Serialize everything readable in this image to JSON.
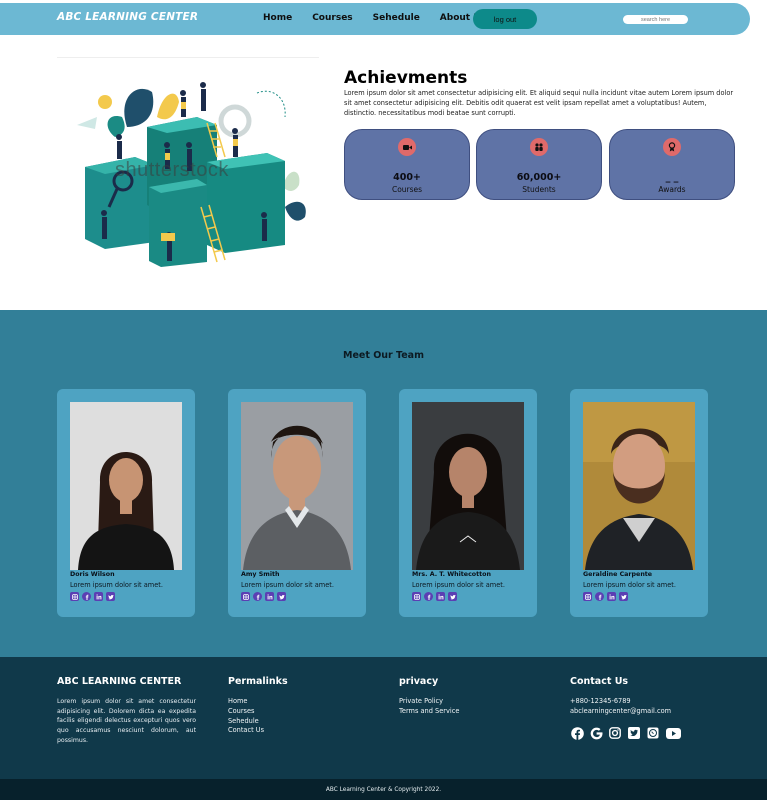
{
  "nav": {
    "brand": "ABC LEARNING CENTER",
    "links": [
      "Home",
      "Courses",
      "Sehedule",
      "About Us"
    ],
    "logout_label": "log out",
    "search_placeholder": "search here"
  },
  "achievements": {
    "title": "Achievments",
    "text": "Lorem ipsum dolor sit amet consectetur adipisicing elit. Et aliquid sequi nulla incidunt vitae autem Lorem ipsum dolor sit amet consectetur adipisicing elit. Debitis odit quaerat est velit ipsam repellat amet a voluptatibus! Autem, distinctio. necessitatibus modi beatae sunt corrupti.",
    "watermark": "shutterstock",
    "stats": [
      {
        "icon": "video-camera-icon",
        "value": "400+",
        "label": "Courses"
      },
      {
        "icon": "people-icon",
        "value": "60,000+",
        "label": "Students"
      },
      {
        "icon": "award-icon",
        "value": "_ _",
        "label": "Awards"
      }
    ]
  },
  "team": {
    "title": "Meet Our Team",
    "members": [
      {
        "name": "Doris Wilson",
        "desc": "Lorem ipsum dolor sit amet."
      },
      {
        "name": "Amy Smith",
        "desc": "Lorem ipsum dolor sit amet."
      },
      {
        "name": "Mrs. A. T. Whitecotton",
        "desc": "Lorem ipsum dolor sit amet."
      },
      {
        "name": "Geraldine Carpente",
        "desc": "Lorem ipsum dolor sit amet."
      }
    ],
    "social_icons": [
      "instagram-icon",
      "facebook-icon",
      "linkedin-icon",
      "twitter-icon"
    ]
  },
  "footer": {
    "about_title": "ABC LEARNING CENTER",
    "about_text": "Lorem ipsum dolor sit amet consectetur adipisicing elit. Dolorem dicta ea expedita facilis eligendi delectus excepturi quos vero quo accusamus nesciunt dolorum, aut possimus.",
    "permalinks_title": "Permalinks",
    "permalinks": [
      "Home",
      "Courses",
      "Sehedule",
      "Contact Us"
    ],
    "privacy_title": "privacy",
    "privacy_links": [
      "Private Policy",
      "Terms and Service"
    ],
    "contact_title": "Contact Us",
    "phone": "+880-12345-6789",
    "email": "abclearningcenter@gmail.com",
    "contact_icons": [
      "facebook-icon",
      "google-icon",
      "instagram-icon",
      "twitter-icon",
      "whatsapp-icon",
      "youtube-icon"
    ],
    "copyright": "ABC Learning Center & Copyright 2022."
  },
  "colors": {
    "nav_bg": "#6cb8d3",
    "logout_bg": "#0d8a8a",
    "stat_bg": "#5f73a6",
    "stat_icon_bg": "#e06a6a",
    "team_bg": "#327f98",
    "card_bg": "#4ea3c2",
    "footer_bg": "#10394a",
    "copyright_bg": "#07212c"
  }
}
